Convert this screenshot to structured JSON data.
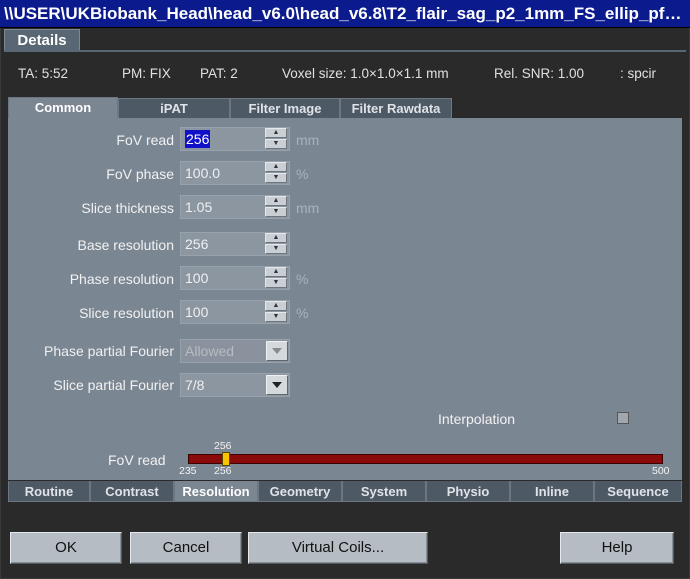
{
  "window": {
    "title": "\\\\USER\\UKBiobank_Head\\head_v6.0\\head_v6.8\\T2_flair_sag_p2_1mm_FS_ellip_pf…",
    "section_tab": "Details"
  },
  "info": {
    "ta": "TA: 5:52",
    "pm": "PM: FIX",
    "pat": "PAT: 2",
    "voxel": "Voxel size: 1.0×1.0×1.1 mm",
    "snr": "Rel. SNR: 1.00",
    "seq": ": spcir"
  },
  "top_tabs": [
    "Common",
    "iPAT",
    "Filter Image",
    "Filter Rawdata"
  ],
  "fields": {
    "fov_read": {
      "label": "FoV read",
      "value": "256",
      "unit": "mm"
    },
    "fov_phase": {
      "label": "FoV phase",
      "value": "100.0",
      "unit": "%"
    },
    "slice_thickness": {
      "label": "Slice thickness",
      "value": "1.05",
      "unit": "mm"
    },
    "base_resolution": {
      "label": "Base resolution",
      "value": "256"
    },
    "phase_resolution": {
      "label": "Phase resolution",
      "value": "100",
      "unit": "%"
    },
    "slice_resolution": {
      "label": "Slice resolution",
      "value": "100",
      "unit": "%"
    },
    "phase_partial_fourier": {
      "label": "Phase partial Fourier",
      "value": "Allowed"
    },
    "slice_partial_fourier": {
      "label": "Slice partial Fourier",
      "value": "7/8"
    },
    "interpolation": {
      "label": "Interpolation",
      "checked": false
    }
  },
  "fov_slider": {
    "label": "FoV read",
    "min_label": "235",
    "max_label": "500",
    "current_label": "256",
    "current_below": "256",
    "min": 235,
    "max": 500,
    "value": 256,
    "track_color": "#8a0a0a",
    "thumb_color": "#f7c400"
  },
  "bottom_tabs": [
    "Routine",
    "Contrast",
    "Resolution",
    "Geometry",
    "System",
    "Physio",
    "Inline",
    "Sequence"
  ],
  "buttons": {
    "ok": "OK",
    "cancel": "Cancel",
    "virtual_coils": "Virtual Coils...",
    "help": "Help"
  },
  "icons": {
    "spin_up": "spin-up-arrow-icon",
    "spin_down": "spin-down-arrow-icon",
    "combo": "chevron-down-icon"
  }
}
